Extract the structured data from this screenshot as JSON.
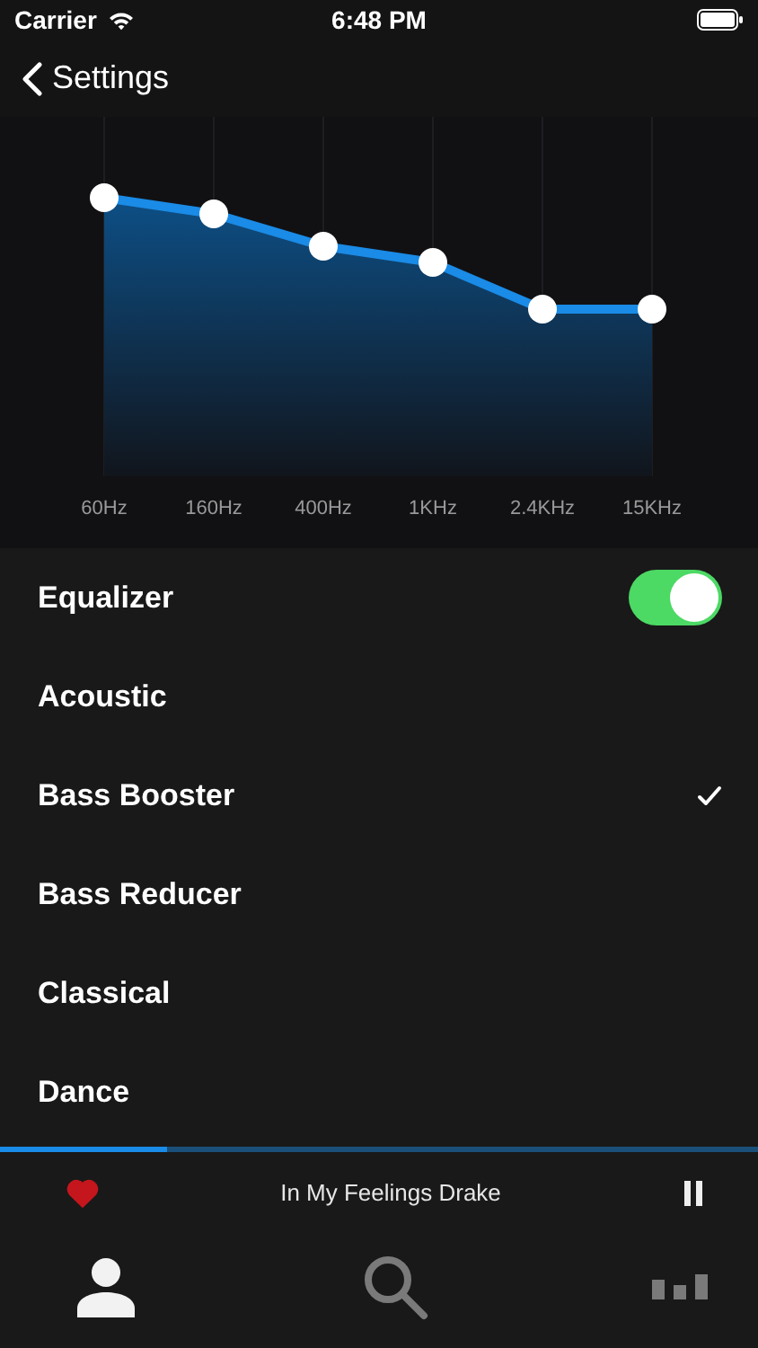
{
  "status_bar": {
    "carrier": "Carrier",
    "time": "6:48 PM"
  },
  "nav": {
    "back_label": "Settings"
  },
  "equalizer_chart": {
    "bands": [
      "60Hz",
      "160Hz",
      "400Hz",
      "1KHz",
      "2.4KHz",
      "15KHz"
    ]
  },
  "settings": [
    {
      "kind": "toggle",
      "label": "Equalizer",
      "on": true
    },
    {
      "kind": "preset",
      "label": "Acoustic",
      "selected": false
    },
    {
      "kind": "preset",
      "label": "Bass Booster",
      "selected": true
    },
    {
      "kind": "preset",
      "label": "Bass Reducer",
      "selected": false
    },
    {
      "kind": "preset",
      "label": "Classical",
      "selected": false
    },
    {
      "kind": "preset",
      "label": "Dance",
      "selected": false
    }
  ],
  "now_playing": {
    "title": "In My Feelings Drake",
    "liked": true,
    "playing": true,
    "level": 0.22
  },
  "tab_bar": [
    {
      "kind": "profile",
      "selected": true
    },
    {
      "kind": "search",
      "selected": false
    },
    {
      "kind": "stats",
      "selected": false
    }
  ]
}
